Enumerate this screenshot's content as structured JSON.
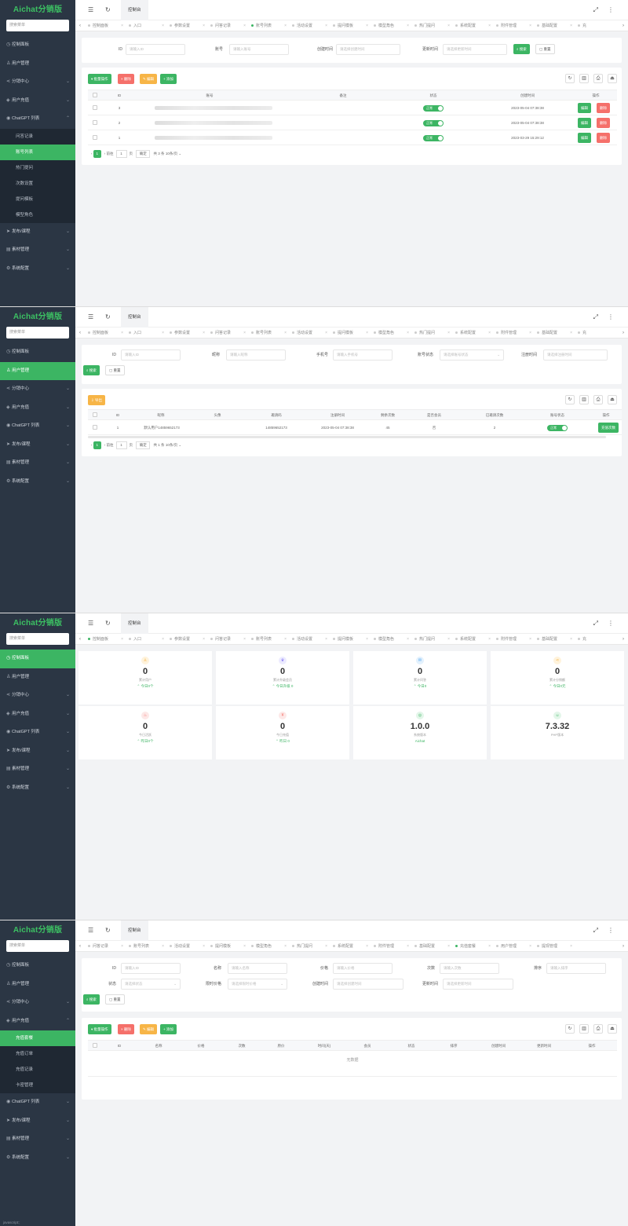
{
  "app": {
    "logo": "Aichat分销版",
    "search_placeholder": "搜索菜单"
  },
  "menu": {
    "dashboard": "控制面板",
    "users": "用户管理",
    "distribution": "分销中心",
    "recharge": "用户充值",
    "chatgpt": "ChatGPT 列表",
    "release": "发布/课程",
    "content": "素材管理",
    "system": "系统配置",
    "chatgpt_sub": [
      "问答记录",
      "账号列表",
      "热门提问",
      "次数设置",
      "提问模板",
      "模型角色"
    ],
    "recharge_sub": [
      "充值套餐",
      "充值订单",
      "充值记录",
      "卡密管理"
    ]
  },
  "topbar": {
    "home_tab": "控制台"
  },
  "tabs_a": [
    "控制面板",
    "入口",
    "参数设置",
    "问答记录",
    "账号列表",
    "活动设置",
    "提问模板",
    "模型角色",
    "热门提问",
    "系统配置",
    "附件管理",
    "基础配置",
    "充"
  ],
  "tabs_b": [
    "问答记录",
    "账号列表",
    "活动设置",
    "提问模板",
    "模型角色",
    "热门提问",
    "系统配置",
    "附件管理",
    "基础配置",
    "充值套餐",
    "用户管理",
    "提现管理"
  ],
  "accounts": {
    "filters": {
      "id_label": "ID",
      "id_placeholder": "请输入ID",
      "account_label": "账号",
      "account_placeholder": "请输入账号",
      "created_label": "创建时间",
      "created_placeholder": "请选择创建时间",
      "updated_label": "更新时间",
      "updated_placeholder": "请选择更新时间",
      "search": "搜索",
      "reset": "重置"
    },
    "toolbar": {
      "bulk": "批量操作",
      "delete": "删除",
      "edit": "编辑",
      "add": "添加"
    },
    "columns": [
      "ID",
      "账号",
      "备注",
      "状态",
      "创建时间",
      "操作"
    ],
    "rows": [
      {
        "id": "3",
        "status": "正常",
        "time": "2023-05-04 07:38:38"
      },
      {
        "id": "2",
        "status": "正常",
        "time": "2023-05-04 07:38:38"
      },
      {
        "id": "1",
        "status": "正常",
        "time": "2023-03-29 15:29:12"
      }
    ],
    "row_edit": "编辑",
    "row_delete": "删除",
    "pager": {
      "page": "1",
      "prefix": "前往",
      "goto": "1",
      "page_unit": "页",
      "confirm": "确定",
      "total": "共 3 条",
      "size": "10条/页"
    }
  },
  "users": {
    "filters": {
      "id_label": "ID",
      "id_placeholder": "请输入ID",
      "nick_label": "昵称",
      "nick_placeholder": "请输入昵称",
      "phone_label": "手机号",
      "phone_placeholder": "请输入手机号",
      "status_label": "账号状态",
      "status_placeholder": "请选择账号状态",
      "reg_label": "注册时间",
      "reg_placeholder": "请选择注册时间",
      "search": "搜索",
      "reset": "重置"
    },
    "toolbar": {
      "export": "导出"
    },
    "columns": [
      "ID",
      "昵称",
      "头像",
      "邀请码",
      "注册时间",
      "剩余次数",
      "是否会员",
      "已邀请次数",
      "账号状态",
      "操作"
    ],
    "row": {
      "id": "1",
      "nick": "默认用户14859652173",
      "code": "14859652173",
      "time": "2023-05-04 07:38:38",
      "count": "45",
      "vip": "否",
      "invited": "2",
      "status": "正常",
      "op": "充值次数"
    },
    "pager": {
      "page": "1",
      "prefix": "前往",
      "goto": "1",
      "page_unit": "页",
      "confirm": "确定",
      "total": "共 1 条",
      "size": "10条/页"
    }
  },
  "dashboard": {
    "stats": [
      {
        "value": "0",
        "label": "累计用户",
        "change": "今日0个",
        "color": "#f7b547",
        "icon": "user-icon"
      },
      {
        "value": "0",
        "label": "累计升级会员",
        "change": "今日升级 0",
        "color": "#8a7cf5",
        "icon": "vip-icon"
      },
      {
        "value": "0",
        "label": "累计问答",
        "change": "今日0",
        "color": "#4aa3f0",
        "icon": "chat-icon"
      },
      {
        "value": "0",
        "label": "累计分销额",
        "change": "今日0元",
        "color": "#f7b547",
        "icon": "share-icon"
      },
      {
        "value": "0",
        "label": "今日活跃",
        "change": "昨日0个",
        "color": "#f5706a",
        "icon": "fire-icon"
      },
      {
        "value": "0",
        "label": "今日充值",
        "change": "昨日 0",
        "color": "#f5706a",
        "icon": "money-icon"
      },
      {
        "value": "1.0.0",
        "label": "系统版本",
        "change": "Aichat",
        "color": "#3cb563",
        "icon": "version-icon"
      },
      {
        "value": "7.3.32",
        "label": "PHP版本",
        "change": "",
        "color": "#3cb563",
        "icon": "php-icon"
      }
    ]
  },
  "packages": {
    "filters": {
      "id_label": "ID",
      "id_placeholder": "请输入ID",
      "name_label": "名称",
      "name_placeholder": "请输入名称",
      "price_label": "价格",
      "price_placeholder": "请输入价格",
      "times_label": "次数",
      "times_placeholder": "请输入次数",
      "sort_label": "排序",
      "sort_placeholder": "请输入排序",
      "status_label": "状态",
      "status_placeholder": "请选择状态",
      "limit_label": "限时价格",
      "limit_placeholder": "请选择限时价格",
      "created_label": "创建时间",
      "created_placeholder": "请选择创建时间",
      "updated_label": "更新时间",
      "updated_placeholder": "请选择更新时间",
      "search": "搜索",
      "reset": "重置"
    },
    "toolbar": {
      "bulk": "批量操作",
      "delete": "删除",
      "edit": "编辑",
      "add": "添加"
    },
    "columns": [
      "ID",
      "名称",
      "价格",
      "次数",
      "原价",
      "时间(天)",
      "会员",
      "状态",
      "排序",
      "创建时间",
      "更新时间",
      "操作"
    ],
    "empty": "无数据"
  },
  "footer": {
    "status": "javascript:;"
  }
}
